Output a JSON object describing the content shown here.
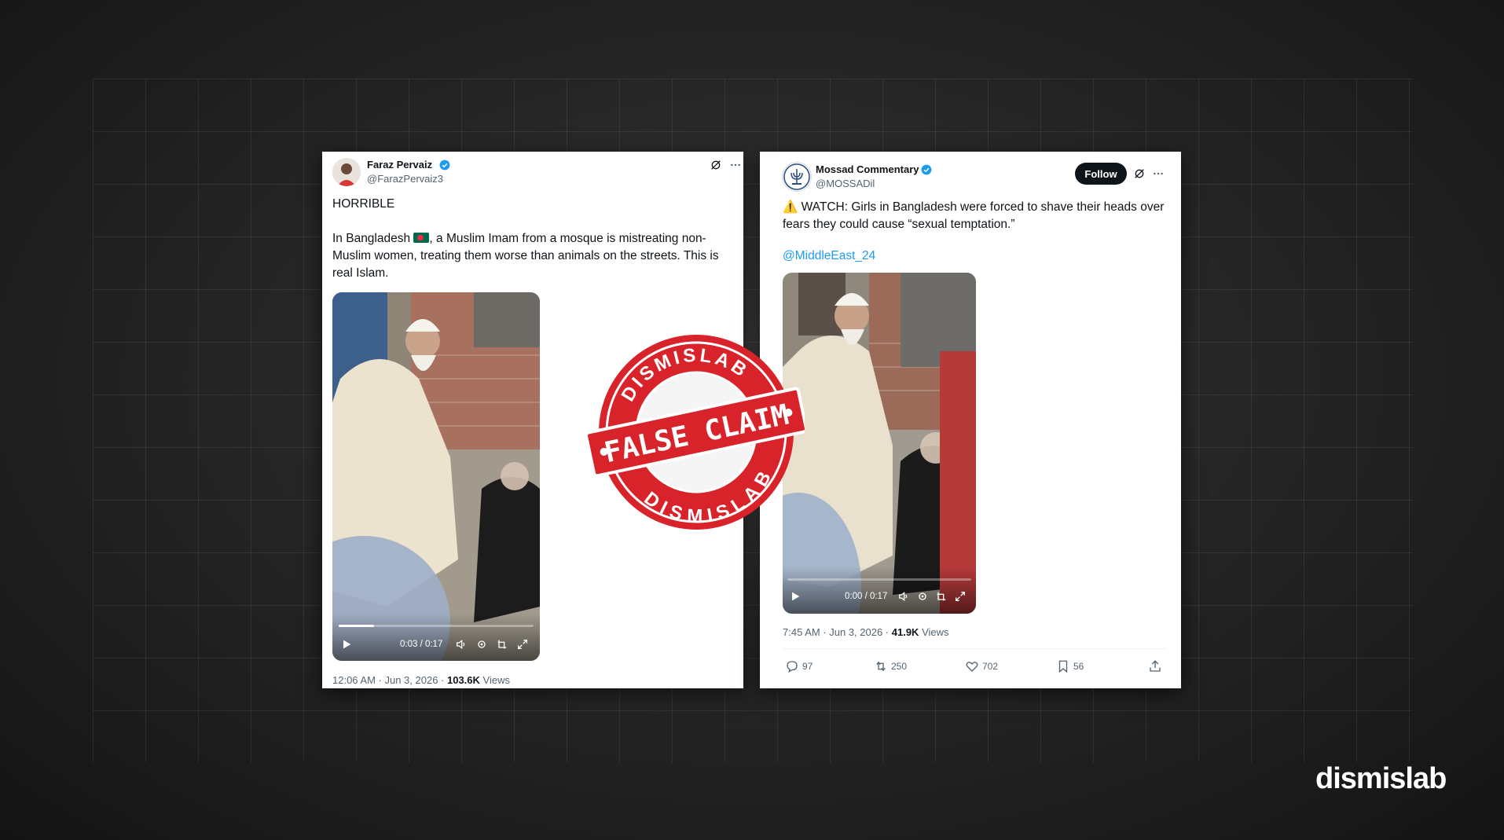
{
  "tweet_left": {
    "name": "Faraz Pervaiz",
    "handle": "@FarazPervaiz3",
    "headline": "HORRIBLE",
    "text_before_flag": "In Bangladesh",
    "text_after_flag": ", a Muslim Imam from a mosque is mistreating non-Muslim women, treating them worse than animals on the streets. This is real Islam.",
    "video_time": "0:03 / 0:17",
    "video_progress": 0.18,
    "meta_time": "12:06 AM · Jun 3, 2026 · ",
    "views_count": "103.6K",
    "views_label": " Views"
  },
  "tweet_right": {
    "name": "Mossad Commentary",
    "handle": "@MOSSADil",
    "follow_label": "Follow",
    "text": "⚠️ WATCH: Girls in Bangladesh were forced to shave their heads over fears they could cause “sexual temptation.”",
    "mention": "@MiddleEast_24",
    "video_time": "0:00 / 0:17",
    "video_progress": 0.0,
    "meta_time": "7:45 AM · Jun 3, 2026 · ",
    "views_count": "41.9K",
    "views_label": " Views",
    "actions": {
      "replies": "97",
      "reposts": "250",
      "likes": "702",
      "bookmarks": "56"
    }
  },
  "stamp": {
    "top_text": "DISMISLAB",
    "center_text": "FALSE CLAIM",
    "bottom_text": "DISMISLAB"
  },
  "brand": "dismislab",
  "colors": {
    "stamp_red": "#d8232a",
    "verified_blue": "#1d9bf0",
    "link_blue": "#1d9bf0"
  }
}
